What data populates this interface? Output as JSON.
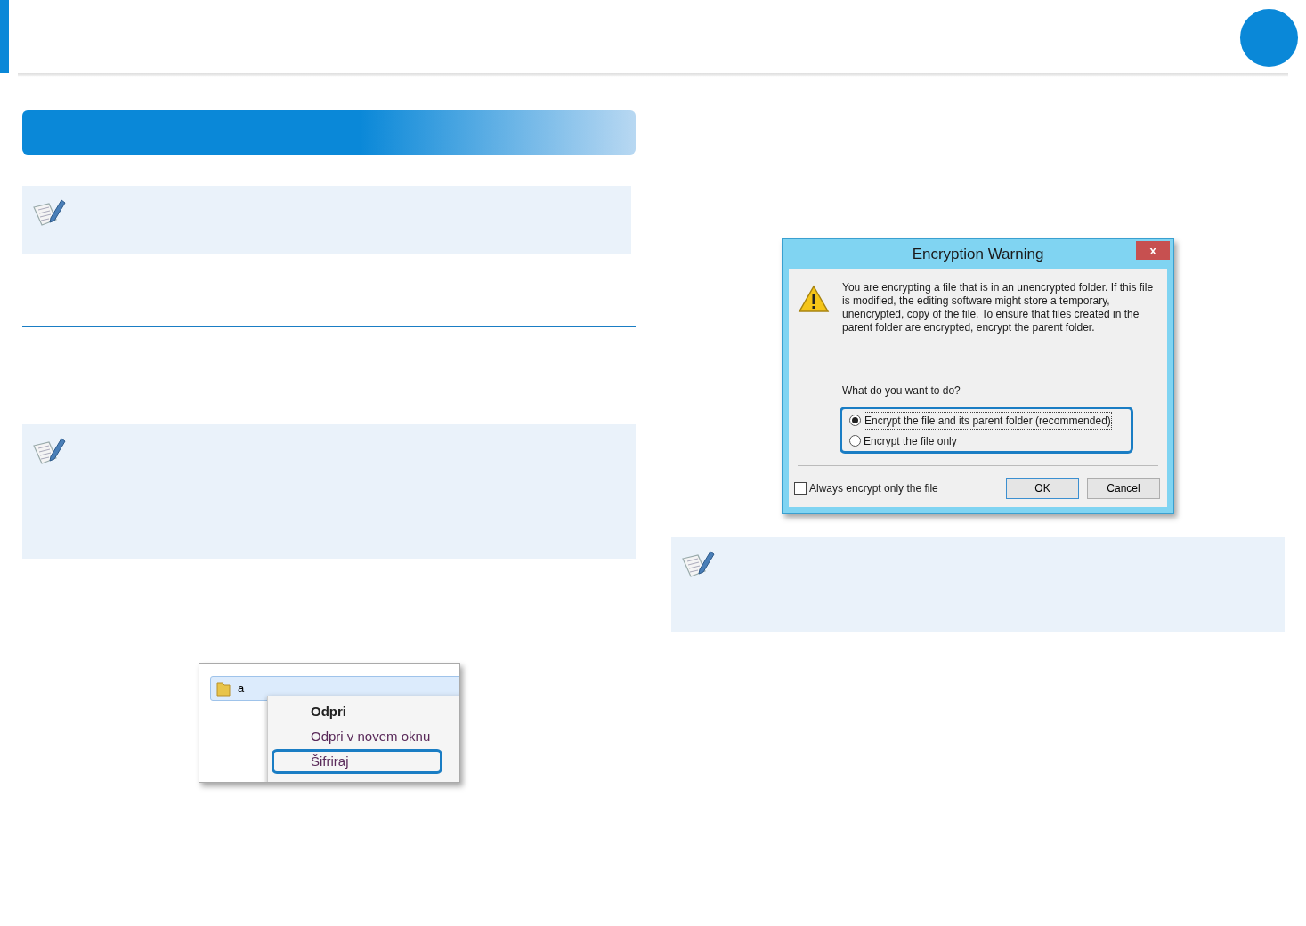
{
  "context_menu_screenshot": {
    "folder": {
      "label": "a"
    },
    "items": [
      {
        "label": "Odpri",
        "kind": "default",
        "highlighted": false
      },
      {
        "label": "Odpri v novem oknu",
        "kind": "normal",
        "highlighted": false
      },
      {
        "label": "Šifriraj",
        "kind": "normal",
        "highlighted": true
      }
    ]
  },
  "dialog": {
    "title": "Encryption Warning",
    "close": "x",
    "message": "You are encrypting a file that is in an unencrypted folder. If this file is modified, the editing software might store a temporary, unencrypted, copy of the file. To ensure that files created in the parent folder are encrypted, encrypt the parent folder.",
    "question": "What do you want to do?",
    "options_highlighted": true,
    "options": [
      {
        "label": "Encrypt the file and its parent folder (recommended)",
        "selected": true
      },
      {
        "label": "Encrypt the file only",
        "selected": false
      }
    ],
    "checkbox": {
      "label": "Always encrypt only the file",
      "checked": false
    },
    "buttons": [
      {
        "label": "OK",
        "kind": "default"
      },
      {
        "label": "Cancel",
        "kind": "normal"
      }
    ]
  }
}
